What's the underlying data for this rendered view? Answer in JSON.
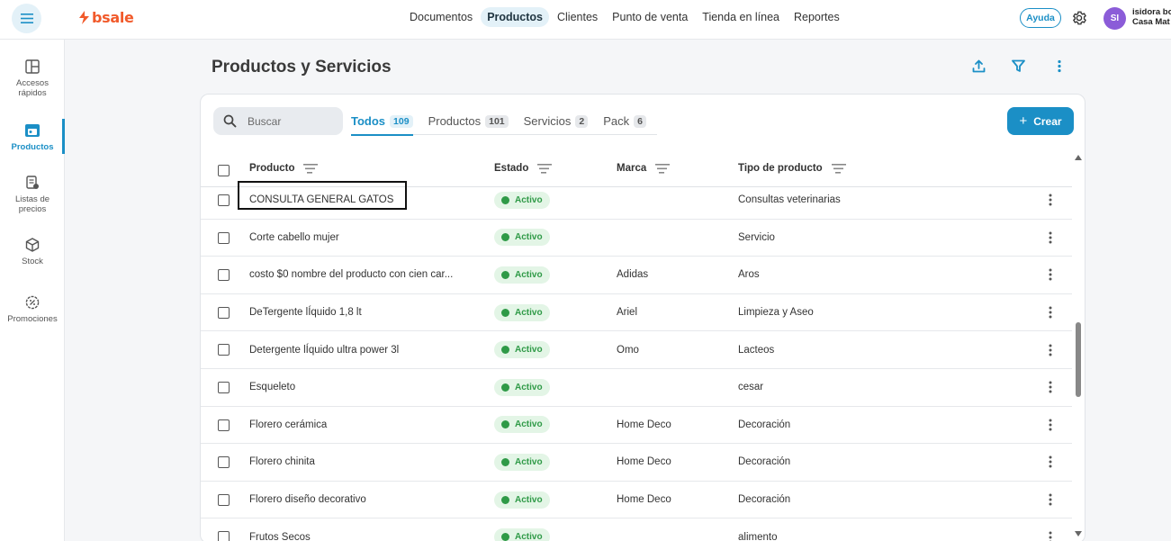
{
  "brand": {
    "name": "bsale",
    "color": "#f15a2b"
  },
  "nav": {
    "items": [
      {
        "label": "Documentos",
        "active": false
      },
      {
        "label": "Productos",
        "active": true
      },
      {
        "label": "Clientes",
        "active": false
      },
      {
        "label": "Punto de venta",
        "active": false
      },
      {
        "label": "Tienda en línea",
        "active": false
      },
      {
        "label": "Reportes",
        "active": false
      }
    ]
  },
  "header_right": {
    "help_label": "Ayuda",
    "settings_icon": "gear-icon",
    "avatar_initials": "SI",
    "user_name": "isidora bo",
    "user_company": "Casa Mat"
  },
  "sidebar": {
    "items": [
      {
        "label_1": "Accesos",
        "label_2": "rápidos",
        "icon": "layout-icon",
        "active": false
      },
      {
        "label_1": "Productos",
        "label_2": "",
        "icon": "products-icon",
        "active": true
      },
      {
        "label_1": "Listas de",
        "label_2": "precios",
        "icon": "price-list-icon",
        "active": false
      },
      {
        "label_1": "Stock",
        "label_2": "",
        "icon": "cube-icon",
        "active": false
      },
      {
        "label_1": "Promociones",
        "label_2": "",
        "icon": "discount-icon",
        "active": false
      }
    ]
  },
  "page": {
    "title": "Productos y Servicios",
    "actions": [
      "upload-icon",
      "filter-icon",
      "more-vertical-icon"
    ]
  },
  "search": {
    "placeholder": "Buscar",
    "value": ""
  },
  "tabs": [
    {
      "label": "Todos",
      "count": "109",
      "active": true
    },
    {
      "label": "Productos",
      "count": "101",
      "active": false
    },
    {
      "label": "Servicios",
      "count": "2",
      "active": false
    },
    {
      "label": "Pack",
      "count": "6",
      "active": false
    }
  ],
  "create_button": {
    "label": "Crear",
    "color": "#1b8fc6"
  },
  "table": {
    "columns": [
      "Producto",
      "Estado",
      "Marca",
      "Tipo de producto"
    ],
    "rows": [
      {
        "producto": "CONSULTA GENERAL GATOS",
        "estado": "Activo",
        "marca": "",
        "tipo": "Consultas veterinarias"
      },
      {
        "producto": "Corte cabello mujer",
        "estado": "Activo",
        "marca": "",
        "tipo": "Servicio"
      },
      {
        "producto": "costo $0 nombre del producto con cien car...",
        "estado": "Activo",
        "marca": "Adidas",
        "tipo": "Aros"
      },
      {
        "producto": "DeTergente lÍquido 1,8 lt",
        "estado": "Activo",
        "marca": "Ariel",
        "tipo": "Limpieza y Aseo"
      },
      {
        "producto": "Detergente lÍquido ultra power 3l",
        "estado": "Activo",
        "marca": "Omo",
        "tipo": "Lacteos"
      },
      {
        "producto": "Esqueleto",
        "estado": "Activo",
        "marca": "",
        "tipo": "cesar"
      },
      {
        "producto": "Florero cerámica",
        "estado": "Activo",
        "marca": "Home Deco",
        "tipo": "Decoración"
      },
      {
        "producto": "Florero chinita",
        "estado": "Activo",
        "marca": "Home Deco",
        "tipo": "Decoración"
      },
      {
        "producto": "Florero diseño decorativo",
        "estado": "Activo",
        "marca": "Home Deco",
        "tipo": "Decoración"
      },
      {
        "producto": "Frutos Secos",
        "estado": "Activo",
        "marca": "",
        "tipo": "alimento"
      }
    ]
  },
  "colors": {
    "accent": "#1b8fc6",
    "status_active": "#2f9a47",
    "status_bg": "#e3f5e6"
  }
}
